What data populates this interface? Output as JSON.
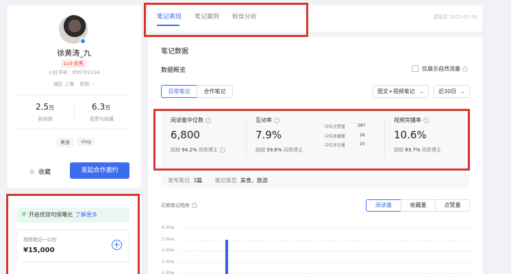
{
  "profile": {
    "name": "徐黄涛_九",
    "level": "Lv3·优秀",
    "xhs_id": "小红书号：955703134",
    "region": "地区 上海",
    "org": "机构 --",
    "fans_value": "2.5",
    "fans_unit": "万",
    "fans_label": "粉丝数",
    "likes_value": "6.3",
    "likes_unit": "万",
    "likes_label": "获赞与收藏",
    "tags": [
      "美食",
      "vlog"
    ],
    "collect_label": "收藏",
    "cta_label": "发起合作邀约"
  },
  "promo": {
    "text": "开启优效可保曝光",
    "link": "了解更多",
    "price_label": "视频笔记一口价",
    "price_value": "¥15,000"
  },
  "tabs": [
    "笔记表现",
    "笔记案例",
    "粉丝分析"
  ],
  "update_time": "更新至 2023-07-20",
  "main": {
    "title": "笔记数据",
    "overview_label": "数据概览",
    "natural_flow_label": "仅展示自然流量",
    "note_types": [
      "日常笔记",
      "合作笔记"
    ],
    "content_filter": "图文+视频笔记",
    "range_filter": "近30日"
  },
  "metrics": {
    "read": {
      "label": "阅读量中位数",
      "value": "6,800",
      "cmp_prefix": "超越",
      "cmp_value": "94.2%",
      "cmp_suffix": "同类博主"
    },
    "interact": {
      "label": "互动率",
      "value": "7.9%",
      "cmp_prefix": "超越",
      "cmp_value": "59.6%",
      "cmp_suffix": "同类博主"
    },
    "mini": [
      {
        "label": "中位点赞量",
        "value": "287"
      },
      {
        "label": "中位收藏量",
        "value": "26"
      },
      {
        "label": "中位评论量",
        "value": "15"
      }
    ],
    "video": {
      "label": "视频完播率",
      "value": "10.6%",
      "cmp_prefix": "超越",
      "cmp_value": "83.7%",
      "cmp_suffix": "同类博主"
    }
  },
  "summary": {
    "publish_label": "发布笔记",
    "publish_value": "3篇",
    "type_label": "笔记类型",
    "type_value": "美食、旅游"
  },
  "trend": {
    "label": "近期笔记趋势",
    "toggles": [
      "阅读量",
      "收藏量",
      "点赞量"
    ]
  },
  "chart_data": {
    "type": "bar",
    "yticks": [
      "6.00w",
      "5.00w",
      "4.00w",
      "3.00w",
      "2.00w"
    ],
    "values": [
      50000
    ],
    "ylim": [
      0,
      60000
    ]
  },
  "colors": {
    "accent": "#3c6cf0",
    "highlight_border": "#d9342b",
    "level_badge": "#e23c37"
  }
}
